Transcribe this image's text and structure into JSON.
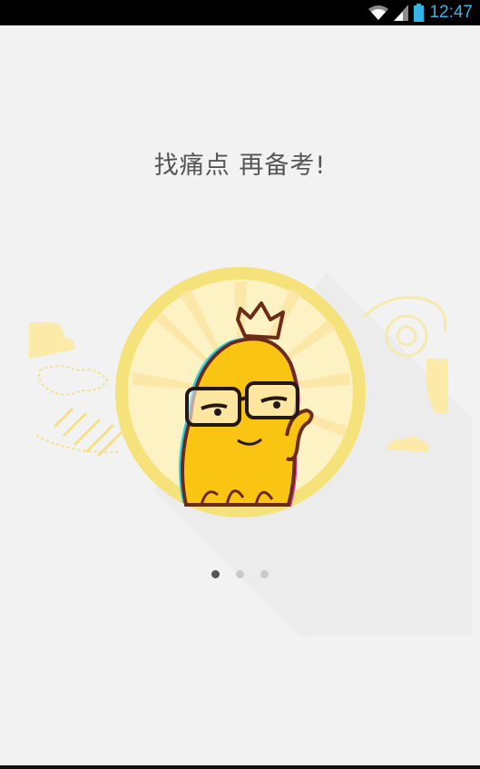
{
  "status_bar": {
    "time": "12:47",
    "icons": [
      "wifi-icon",
      "cell-signal-icon",
      "battery-icon"
    ],
    "accent_color": "#33b5e5"
  },
  "onboarding": {
    "headline": "找痛点 再备考!",
    "illustration": "octopus-mascot-with-crown-and-glasses",
    "pager": {
      "page_count": 3,
      "current_page": 1
    }
  },
  "colors": {
    "background": "#f2f2f2",
    "badge_ring": "#f5e27a",
    "mascot_yellow": "#f9c412",
    "outline_brown": "#6b2a1a"
  }
}
